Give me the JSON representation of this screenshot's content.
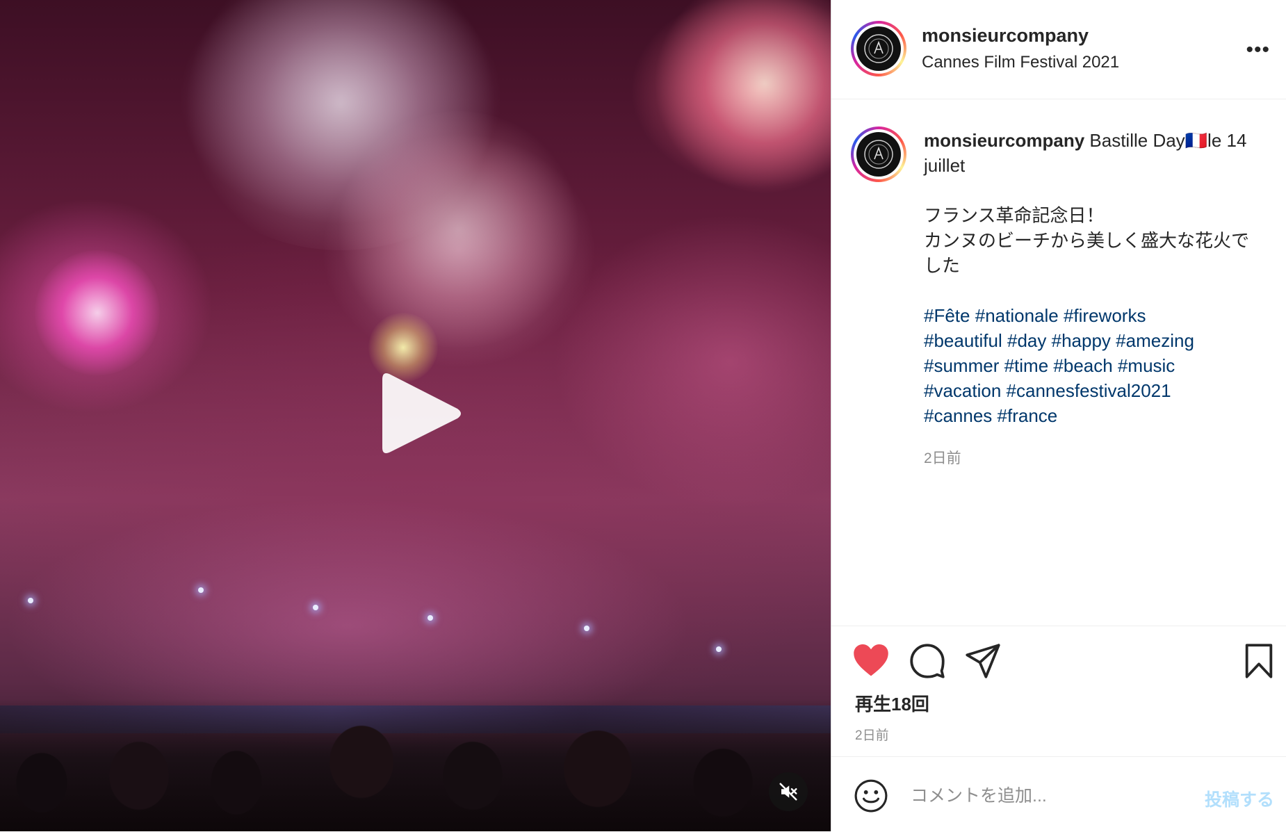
{
  "header": {
    "username": "monsieurcompany",
    "location": "Cannes Film Festival 2021",
    "more_label": "•••"
  },
  "caption": {
    "username": "monsieurcompany",
    "text": "Bastille Day🇫🇷le 14 juillet",
    "jp_lines": [
      "フランス革命記念日！",
      "カンヌのビーチから美しく盛大な花火でした"
    ],
    "hashtags": [
      "#Fête",
      "#nationale",
      "#fireworks",
      "#beautiful",
      "#day",
      "#happy",
      "#amezing",
      "#summer",
      "#time",
      "#beach",
      "#music",
      "#vacation",
      "#cannesfestival2021",
      "#cannes",
      "#france"
    ],
    "time": "2日前"
  },
  "actions": {
    "views": "再生18回",
    "time": "2日前",
    "liked": true
  },
  "comment": {
    "placeholder": "コメントを追加...",
    "post_label": "投稿する"
  },
  "media": {
    "type": "video",
    "muted": true
  },
  "colors": {
    "like": "#ed4956",
    "link": "#00376b",
    "muted_text": "#8e8e8e",
    "post_button": "#b2dffc"
  }
}
